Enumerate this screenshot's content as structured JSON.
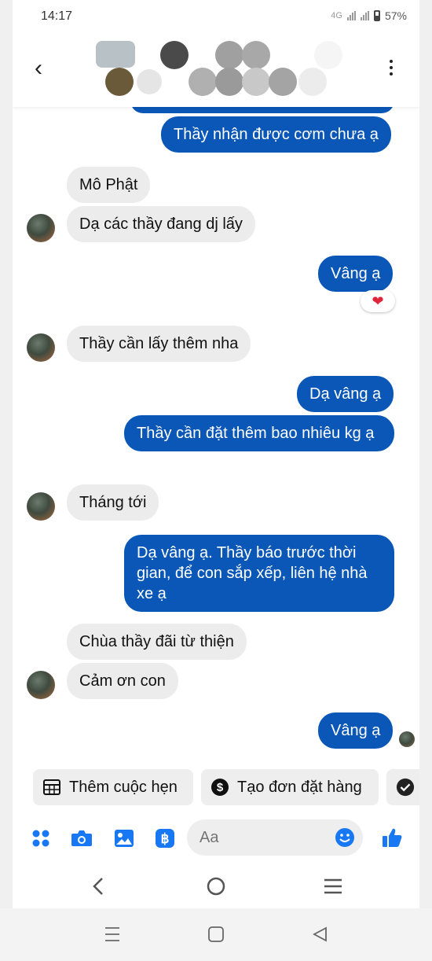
{
  "status_bar": {
    "time": "14:17",
    "network": "4G",
    "battery": "57%"
  },
  "header": {
    "contact_name_obscured": true
  },
  "messages": [
    {
      "dir": "out",
      "text": "Thầy nhận được cơm chưa ạ"
    },
    {
      "dir": "in",
      "text": "Mô Phật"
    },
    {
      "dir": "in",
      "text": "Dạ các thầy đang dj lấy"
    },
    {
      "dir": "out",
      "text": "Vâng ạ",
      "reaction": "heart"
    },
    {
      "dir": "in",
      "text": "Thầy cần lấy thêm nha"
    },
    {
      "dir": "out",
      "text": "Dạ vâng ạ"
    },
    {
      "dir": "out",
      "text": "Thầy cần đặt thêm bao nhiêu kg ạ"
    },
    {
      "dir": "in",
      "text": "Tháng tới"
    },
    {
      "dir": "out",
      "text": "Dạ vâng ạ. Thầy báo trước thời gian, để con sắp xếp, liên hệ nhà xe ạ"
    },
    {
      "dir": "in",
      "text": "Chùa thầy đãi từ thiện"
    },
    {
      "dir": "in",
      "text": "Cảm ơn con"
    },
    {
      "dir": "out",
      "text": "Vâng ạ",
      "seen": true
    }
  ],
  "quick_actions": [
    {
      "label": "Thêm cuộc hẹn",
      "icon": "calendar-icon"
    },
    {
      "label": "Tạo đơn đặt hàng",
      "icon": "dollar-icon"
    },
    {
      "label": "",
      "icon": "check-circle-icon"
    }
  ],
  "composer": {
    "placeholder": "Aa",
    "icons": [
      "apps-icon",
      "camera-icon",
      "gallery-icon",
      "payment-icon",
      "emoji-icon",
      "like-icon"
    ]
  },
  "colors": {
    "outgoing_bubble": "#0a57b7",
    "incoming_bubble": "#ececec",
    "accent": "#1877f2"
  }
}
